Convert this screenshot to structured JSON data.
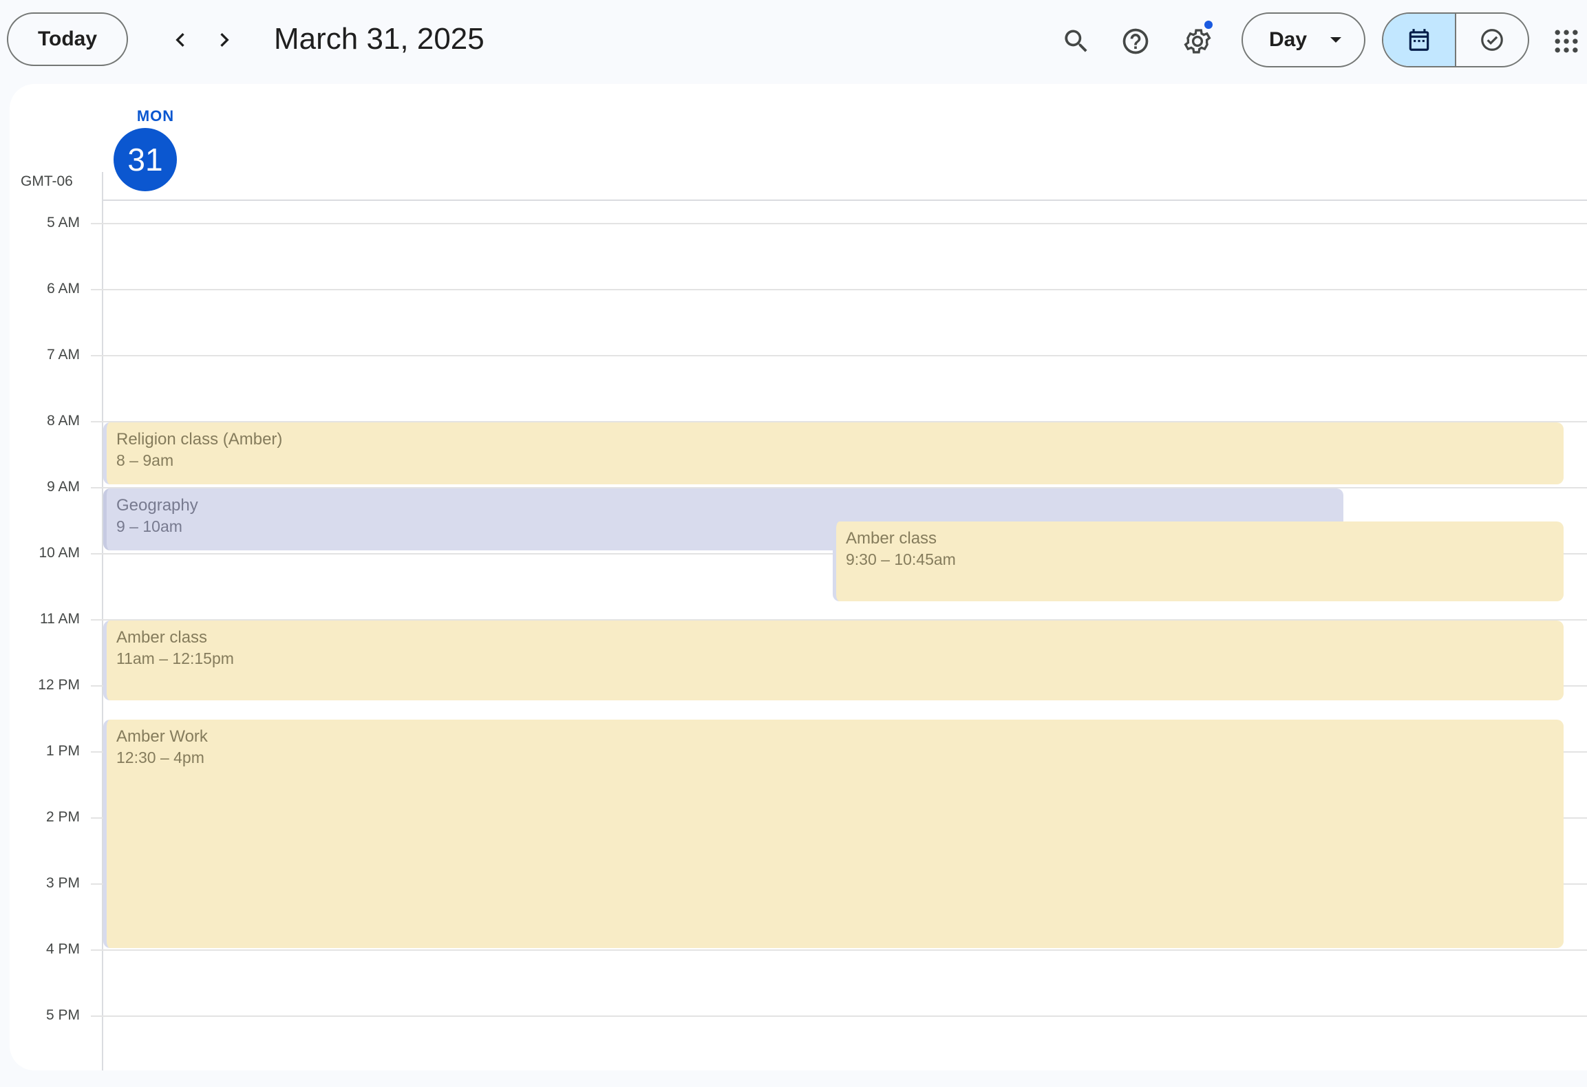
{
  "toolbar": {
    "today_label": "Today",
    "date_title": "March 31, 2025",
    "view_label": "Day"
  },
  "icons": {
    "prev": "chevron-left-icon",
    "next": "chevron-right-icon",
    "search": "search-icon",
    "help": "help-icon",
    "settings": "gear-icon",
    "calendar_view": "calendar-icon",
    "tasks_view": "task-check-icon",
    "apps": "apps-grid-icon"
  },
  "colors": {
    "accent": "#0b57d0",
    "amber_event": "#f8ecc6",
    "geography_event": "#d8dbed",
    "active_segment": "#c2e7ff"
  },
  "day_header": {
    "weekday": "MON",
    "day_number": "31",
    "timezone": "GMT-06"
  },
  "hours": [
    "5 AM",
    "6 AM",
    "7 AM",
    "8 AM",
    "9 AM",
    "10 AM",
    "11 AM",
    "12 PM",
    "1 PM",
    "2 PM",
    "3 PM",
    "4 PM",
    "5 PM"
  ],
  "events": [
    {
      "title": "Religion class (Amber)",
      "time": "8 – 9am",
      "calendar": "amber"
    },
    {
      "title": "Geography",
      "time": "9 – 10am",
      "calendar": "geography"
    },
    {
      "title": "Amber class",
      "time": "9:30 – 10:45am",
      "calendar": "amber"
    },
    {
      "title": "Amber class",
      "time": "11am – 12:15pm",
      "calendar": "amber"
    },
    {
      "title": "Amber Work",
      "time": "12:30 – 4pm",
      "calendar": "amber"
    }
  ]
}
